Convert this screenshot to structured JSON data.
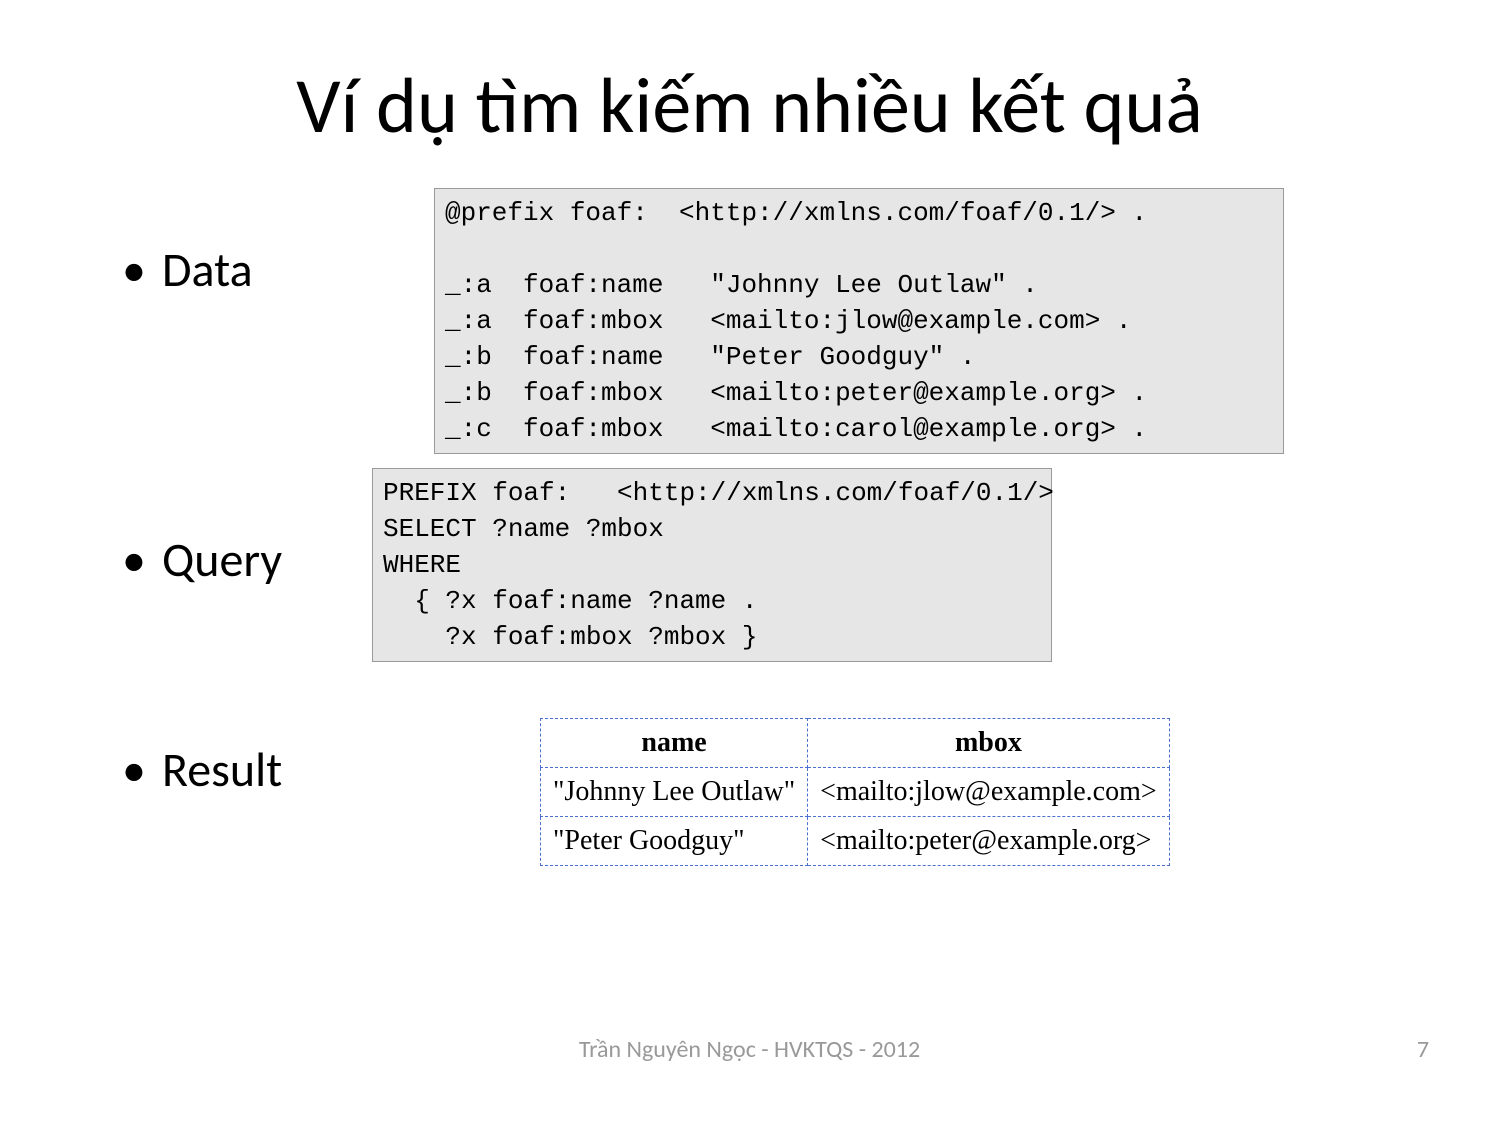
{
  "title": "Ví dụ tìm kiếm nhiều kết quả",
  "bullets": {
    "data": "Data",
    "query": "Query",
    "result": "Result"
  },
  "data_code": "@prefix foaf:  <http://xmlns.com/foaf/0.1/> .\n\n_:a  foaf:name   \"Johnny Lee Outlaw\" .\n_:a  foaf:mbox   <mailto:jlow@example.com> .\n_:b  foaf:name   \"Peter Goodguy\" .\n_:b  foaf:mbox   <mailto:peter@example.org> .\n_:c  foaf:mbox   <mailto:carol@example.org> .",
  "query_code": "PREFIX foaf:   <http://xmlns.com/foaf/0.1/>\nSELECT ?name ?mbox\nWHERE\n  { ?x foaf:name ?name .\n    ?x foaf:mbox ?mbox }",
  "result_table": {
    "headers": [
      "name",
      "mbox"
    ],
    "rows": [
      [
        "\"Johnny Lee Outlaw\"",
        "<mailto:jlow@example.com>"
      ],
      [
        "\"Peter Goodguy\"",
        "<mailto:peter@example.org>"
      ]
    ]
  },
  "footer": {
    "center": "Trần Nguyên Ngọc - HVKTQS - 2012",
    "page": "7"
  }
}
